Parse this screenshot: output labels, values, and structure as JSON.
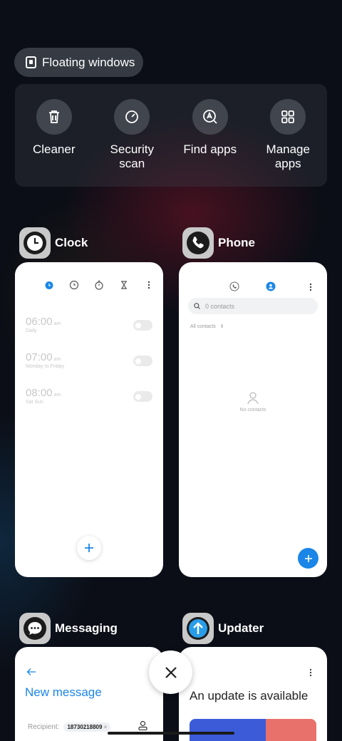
{
  "floating_windows": {
    "label": "Floating windows",
    "icon": "floating-window-icon"
  },
  "tools": [
    {
      "label": "Cleaner",
      "icon": "trash-icon"
    },
    {
      "label": "Security scan",
      "icon": "shield-scan-icon"
    },
    {
      "label": "Find apps",
      "icon": "find-apps-icon"
    },
    {
      "label": "Manage apps",
      "icon": "grid-icon"
    }
  ],
  "apps": {
    "clock": {
      "name": "Clock",
      "alarms": [
        {
          "time": "06:00",
          "ampm": "am",
          "days": "Daily"
        },
        {
          "time": "07:00",
          "ampm": "am",
          "days": "Monday to Friday"
        },
        {
          "time": "08:00",
          "ampm": "am",
          "days": "Sat Sun"
        }
      ]
    },
    "phone": {
      "name": "Phone",
      "search_placeholder": "0 contacts",
      "filter": "All contacts",
      "empty": "No contacts"
    },
    "messaging": {
      "name": "Messaging",
      "title": "New message",
      "recipient_label": "Recipient:",
      "recipient_chip": "18730218809",
      "chip_remove": "×"
    },
    "updater": {
      "name": "Updater",
      "title": "An update is available"
    }
  },
  "colors": {
    "accent": "#1b86e8",
    "background": "#0b0e16"
  }
}
